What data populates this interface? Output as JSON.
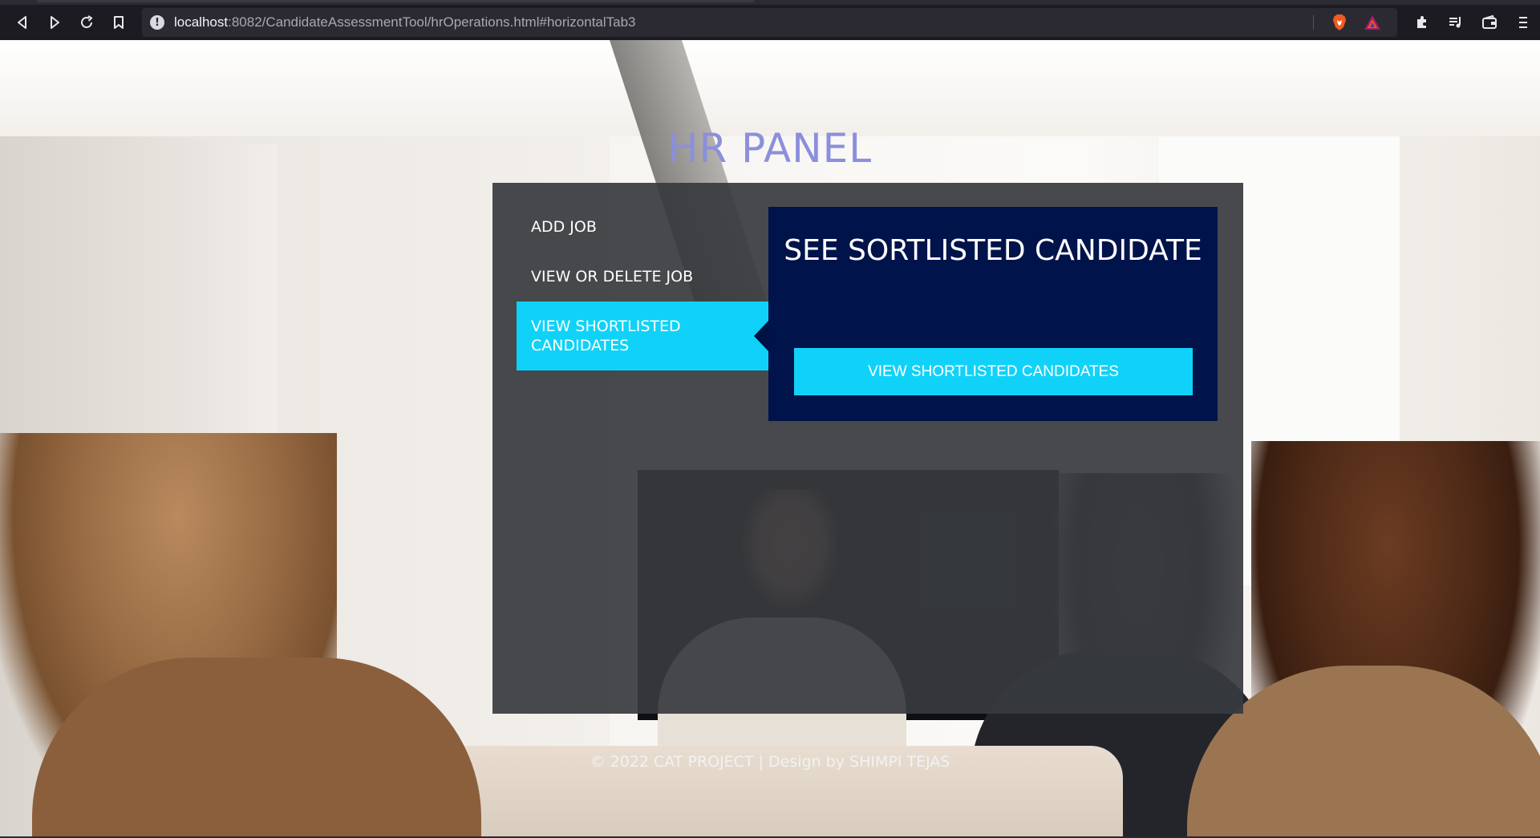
{
  "browser": {
    "url_host": "localhost",
    "url_rest": ":8082/CandidateAssessmentTool/hrOperations.html#horizontalTab3"
  },
  "page": {
    "title": "HR PANEL",
    "tabs": [
      {
        "label": "ADD JOB"
      },
      {
        "label": "VIEW OR DELETE JOB"
      },
      {
        "label": "VIEW SHORTLISTED CANDIDATES",
        "active": true
      }
    ],
    "content": {
      "heading": "SEE SORTLISTED CANDIDATE",
      "button_label": "VIEW SHORTLISTED CANDIDATES"
    },
    "footer": "© 2022 CAT PROJECT | Design by SHIMPI TEJAS"
  },
  "colors": {
    "title": "#8b8fdc",
    "accent": "#10d2f8",
    "content_bg": "#00134a",
    "panel_bg": "#373a3e"
  },
  "icons": [
    "back-icon",
    "forward-icon",
    "reload-icon",
    "bookmark-icon",
    "site-info-icon",
    "brave-shields-icon",
    "brave-rewards-icon",
    "extensions-icon",
    "playlist-icon",
    "wallet-icon",
    "menu-icon"
  ]
}
